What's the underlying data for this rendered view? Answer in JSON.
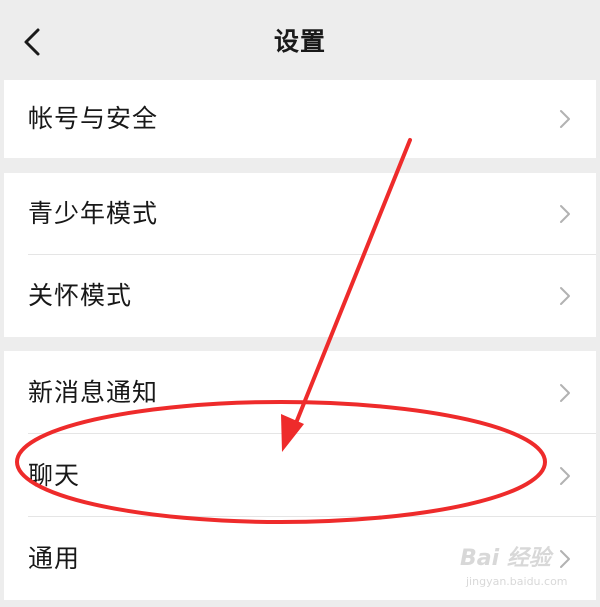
{
  "header": {
    "title": "设置",
    "back_icon": "chevron-left-icon"
  },
  "groups": [
    {
      "rows": [
        {
          "label": "帐号与安全",
          "icon": "chevron-right-icon"
        }
      ]
    },
    {
      "rows": [
        {
          "label": "青少年模式",
          "icon": "chevron-right-icon"
        },
        {
          "label": "关怀模式",
          "icon": "chevron-right-icon"
        }
      ]
    },
    {
      "rows": [
        {
          "label": "新消息通知",
          "icon": "chevron-right-icon"
        },
        {
          "label": "聊天",
          "icon": "chevron-right-icon"
        },
        {
          "label": "通用",
          "icon": "chevron-right-icon"
        }
      ]
    }
  ],
  "annotation": {
    "color": "#ee2b2b",
    "shapes": [
      "arrow",
      "ellipse"
    ]
  },
  "watermark": {
    "logo": "Bai 经验",
    "sub": "jingyan.baidu.com"
  },
  "colors": {
    "background": "#ededed",
    "cell": "#ffffff",
    "text": "#181818",
    "chevron": "#b2b2b2"
  }
}
